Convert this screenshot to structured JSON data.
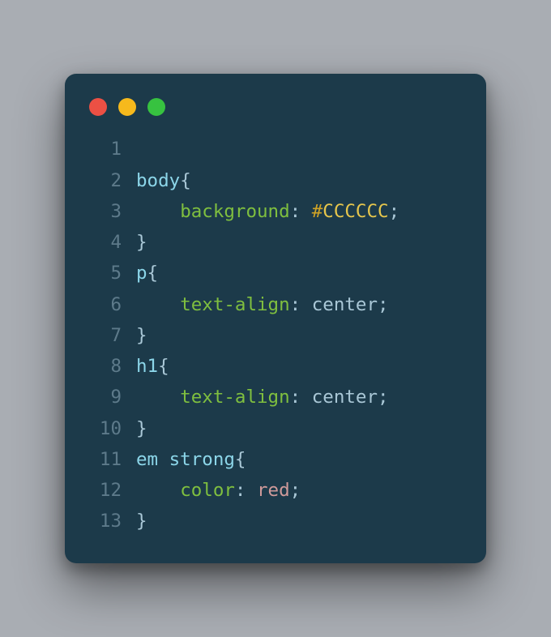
{
  "window": {
    "traffic_light_colors": {
      "close": "#ec5044",
      "minimize": "#f6b91c",
      "zoom": "#37c240"
    },
    "background": "#1c3a4a"
  },
  "code": {
    "language": "css",
    "indent": "    ",
    "total_lines": 13,
    "lines": [
      {
        "n": "1",
        "tokens": []
      },
      {
        "n": "2",
        "tokens": [
          {
            "t": "body",
            "c": "sel"
          },
          {
            "t": "{",
            "c": "brace"
          }
        ]
      },
      {
        "n": "3",
        "tokens": [
          {
            "t": "    ",
            "c": null
          },
          {
            "t": "background",
            "c": "prop"
          },
          {
            "t": ":",
            "c": "punc"
          },
          {
            "t": " ",
            "c": null
          },
          {
            "t": "#",
            "c": "hash"
          },
          {
            "t": "CCCCCC",
            "c": "hex"
          },
          {
            "t": ";",
            "c": "punc"
          }
        ]
      },
      {
        "n": "4",
        "tokens": [
          {
            "t": "}",
            "c": "brace"
          }
        ]
      },
      {
        "n": "5",
        "tokens": [
          {
            "t": "p",
            "c": "sel"
          },
          {
            "t": "{",
            "c": "brace"
          }
        ]
      },
      {
        "n": "6",
        "tokens": [
          {
            "t": "    ",
            "c": null
          },
          {
            "t": "text-align",
            "c": "prop"
          },
          {
            "t": ":",
            "c": "punc"
          },
          {
            "t": " ",
            "c": null
          },
          {
            "t": "center",
            "c": "kw"
          },
          {
            "t": ";",
            "c": "punc"
          }
        ]
      },
      {
        "n": "7",
        "tokens": [
          {
            "t": "}",
            "c": "brace"
          }
        ]
      },
      {
        "n": "8",
        "tokens": [
          {
            "t": "h1",
            "c": "sel"
          },
          {
            "t": "{",
            "c": "brace"
          }
        ]
      },
      {
        "n": "9",
        "tokens": [
          {
            "t": "    ",
            "c": null
          },
          {
            "t": "text-align",
            "c": "prop"
          },
          {
            "t": ":",
            "c": "punc"
          },
          {
            "t": " ",
            "c": null
          },
          {
            "t": "center",
            "c": "kw"
          },
          {
            "t": ";",
            "c": "punc"
          }
        ]
      },
      {
        "n": "10",
        "tokens": [
          {
            "t": "}",
            "c": "brace"
          }
        ]
      },
      {
        "n": "11",
        "tokens": [
          {
            "t": "em",
            "c": "sel"
          },
          {
            "t": " ",
            "c": null
          },
          {
            "t": "strong",
            "c": "sel"
          },
          {
            "t": "{",
            "c": "brace"
          }
        ]
      },
      {
        "n": "12",
        "tokens": [
          {
            "t": "    ",
            "c": null
          },
          {
            "t": "color",
            "c": "prop"
          },
          {
            "t": ":",
            "c": "punc"
          },
          {
            "t": " ",
            "c": null
          },
          {
            "t": "red",
            "c": "kwred"
          },
          {
            "t": ";",
            "c": "punc"
          }
        ]
      },
      {
        "n": "13",
        "tokens": [
          {
            "t": "}",
            "c": "brace"
          }
        ]
      }
    ]
  }
}
